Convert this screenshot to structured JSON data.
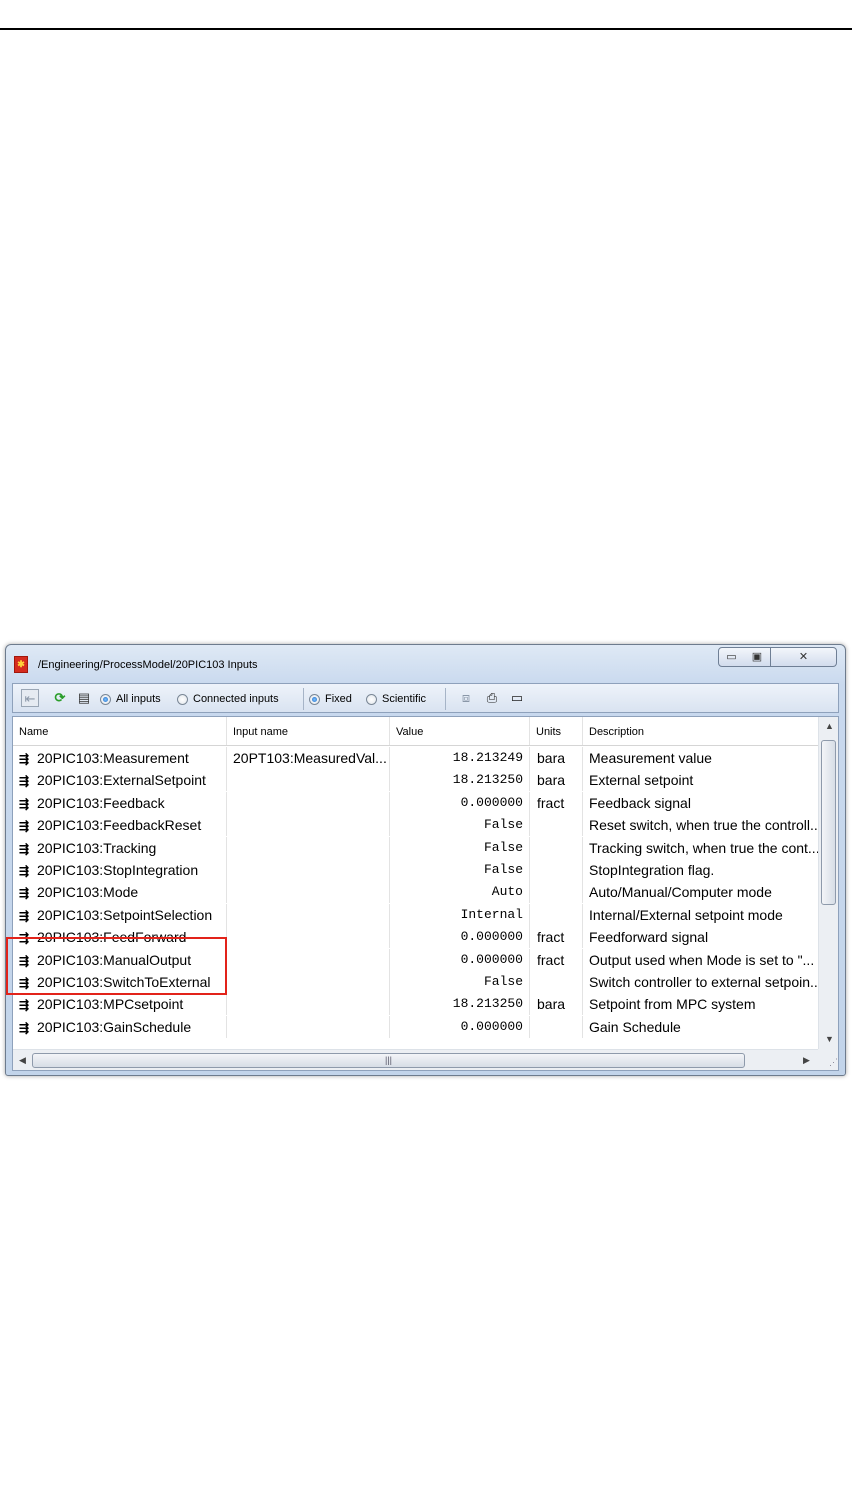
{
  "window": {
    "title": "/Engineering/ProcessModel/20PIC103 Inputs",
    "controls": {
      "minimize": "▭",
      "maximize": "▣",
      "close": "✕"
    }
  },
  "toolbar": {
    "radio_all_inputs": "All inputs",
    "radio_connected_inputs": "Connected inputs",
    "radio_fixed": "Fixed",
    "radio_scientific": "Scientific",
    "selected_scope": "All inputs",
    "selected_format": "Fixed",
    "icons": [
      "back-icon",
      "refresh-icon",
      "filter-icon",
      "connect-icon",
      "print-icon",
      "window-icon"
    ]
  },
  "table": {
    "columns": [
      "Name",
      "Input name",
      "Value",
      "Units",
      "Description"
    ],
    "rows": [
      {
        "name": "20PIC103:Measurement",
        "input": "20PT103:MeasuredVal...",
        "value": "18.213249",
        "units": "bara",
        "desc": "Measurement value"
      },
      {
        "name": "20PIC103:ExternalSetpoint",
        "input": "",
        "value": "18.213250",
        "units": "bara",
        "desc": "External setpoint"
      },
      {
        "name": "20PIC103:Feedback",
        "input": "",
        "value": "0.000000",
        "units": "fract",
        "desc": "Feedback signal"
      },
      {
        "name": "20PIC103:FeedbackReset",
        "input": "",
        "value": "False",
        "units": "",
        "desc": "Reset switch, when true the controll..."
      },
      {
        "name": "20PIC103:Tracking",
        "input": "",
        "value": "False",
        "units": "",
        "desc": "Tracking switch, when true the cont..."
      },
      {
        "name": "20PIC103:StopIntegration",
        "input": "",
        "value": "False",
        "units": "",
        "desc": "StopIntegration flag."
      },
      {
        "name": "20PIC103:Mode",
        "input": "",
        "value": "Auto",
        "units": "",
        "desc": "Auto/Manual/Computer mode"
      },
      {
        "name": "20PIC103:SetpointSelection",
        "input": "",
        "value": "Internal",
        "units": "",
        "desc": "Internal/External setpoint mode"
      },
      {
        "name": "20PIC103:FeedForward",
        "input": "",
        "value": "0.000000",
        "units": "fract",
        "desc": "Feedforward signal"
      },
      {
        "name": "20PIC103:ManualOutput",
        "input": "",
        "value": "0.000000",
        "units": "fract",
        "desc": "Output used when Mode is set to \"..."
      },
      {
        "name": "20PIC103:SwitchToExternal",
        "input": "",
        "value": "False",
        "units": "",
        "desc": "Switch controller to external setpoin..."
      },
      {
        "name": "20PIC103:MPCsetpoint",
        "input": "",
        "value": "18.213250",
        "units": "bara",
        "desc": "Setpoint from MPC system"
      },
      {
        "name": "20PIC103:GainSchedule",
        "input": "",
        "value": "0.000000",
        "units": "",
        "desc": "Gain Schedule"
      }
    ]
  },
  "colors": {
    "highlight": "#e2231a",
    "accent": "#1d6bc7"
  }
}
